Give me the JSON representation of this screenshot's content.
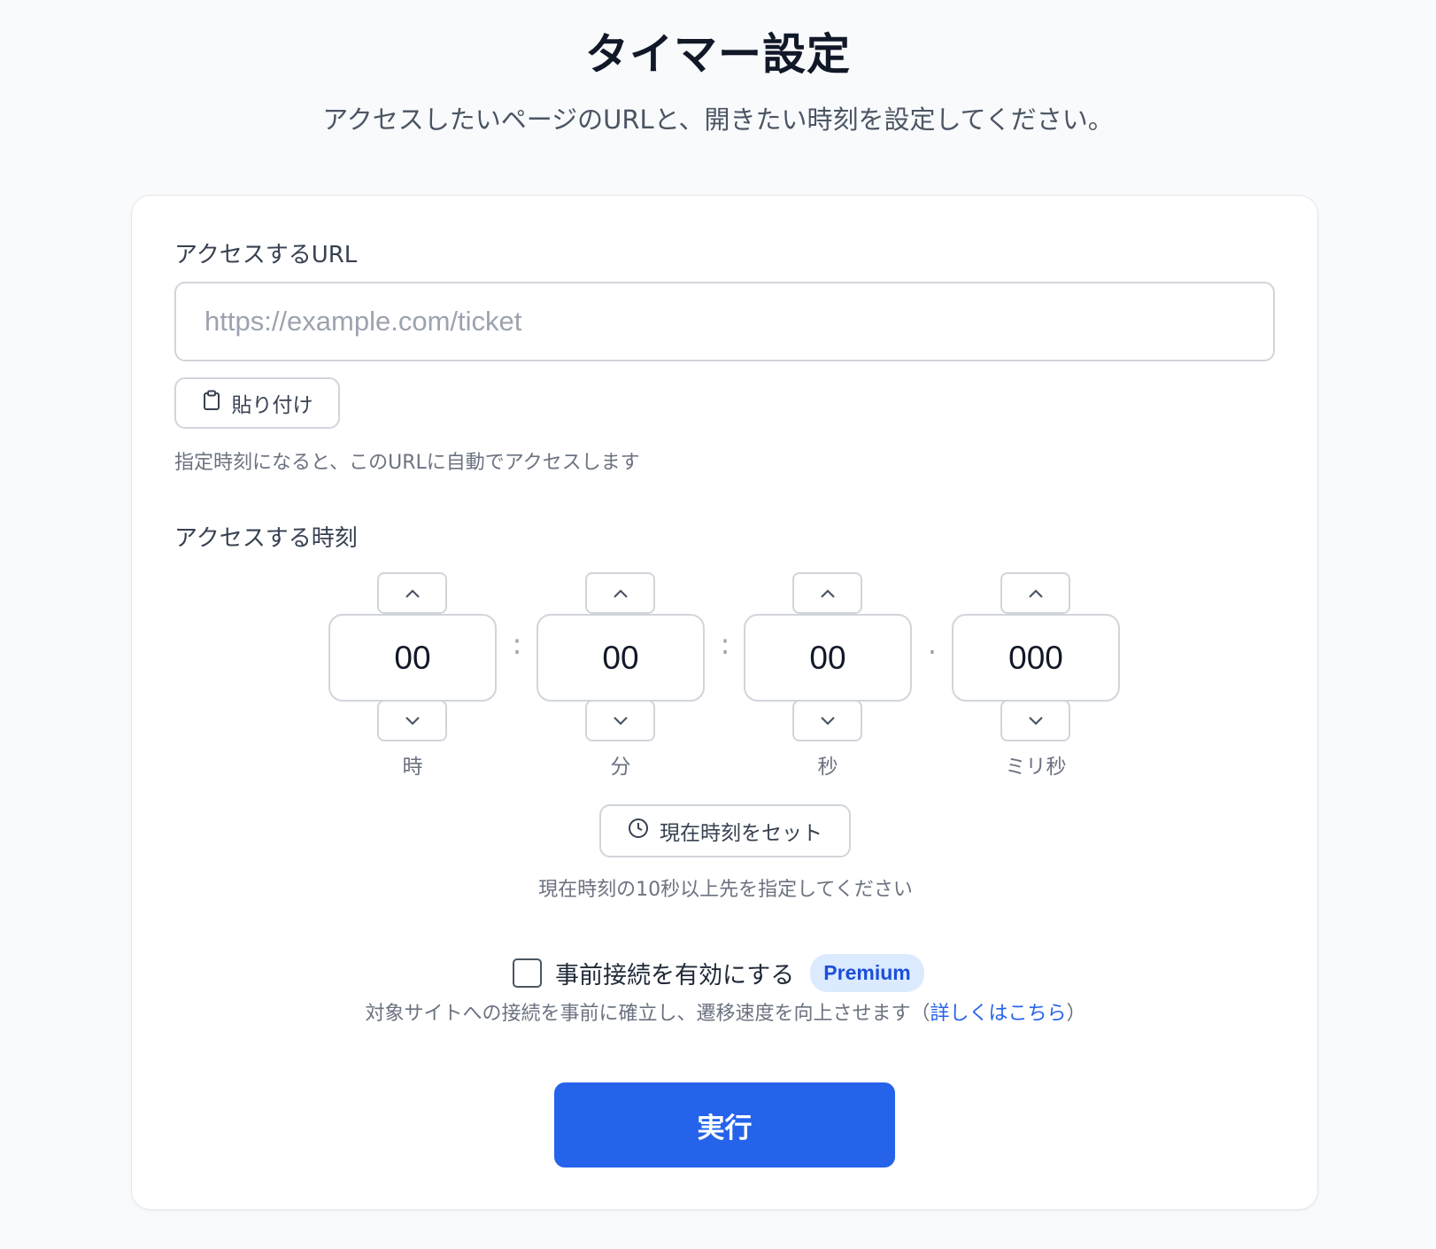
{
  "header": {
    "title": "タイマー設定",
    "subtitle": "アクセスしたいページのURLと、開きたい時刻を設定してください。"
  },
  "url_section": {
    "label": "アクセスするURL",
    "input_value": "",
    "input_placeholder": "https://example.com/ticket",
    "paste_label": "貼り付け",
    "paste_icon": "clipboard-icon",
    "hint": "指定時刻になると、このURLに自動でアクセスします"
  },
  "time_section": {
    "label": "アクセスする時刻",
    "hours": {
      "value": "00",
      "unit": "時"
    },
    "minutes": {
      "value": "00",
      "unit": "分"
    },
    "seconds": {
      "value": "00",
      "unit": "秒"
    },
    "milliseconds": {
      "value": "000",
      "unit": "ミリ秒"
    },
    "separators": [
      ":",
      ":",
      "."
    ],
    "now_button_label": "現在時刻をセット",
    "now_button_icon": "clock-icon",
    "hint": "現在時刻の10秒以上先を指定してください"
  },
  "preconnect": {
    "checked": false,
    "label": "事前接続を有効にする",
    "badge": "Premium",
    "description_prefix": "対象サイトへの接続を事前に確立し、遷移速度を向上させます（",
    "link_text": "詳しくはこちら",
    "description_suffix": "）"
  },
  "actions": {
    "run_label": "実行"
  },
  "colors": {
    "primary": "#2563eb",
    "badge_bg": "#dbeafe",
    "badge_text": "#1d4ed8",
    "background": "#f8fafc"
  }
}
